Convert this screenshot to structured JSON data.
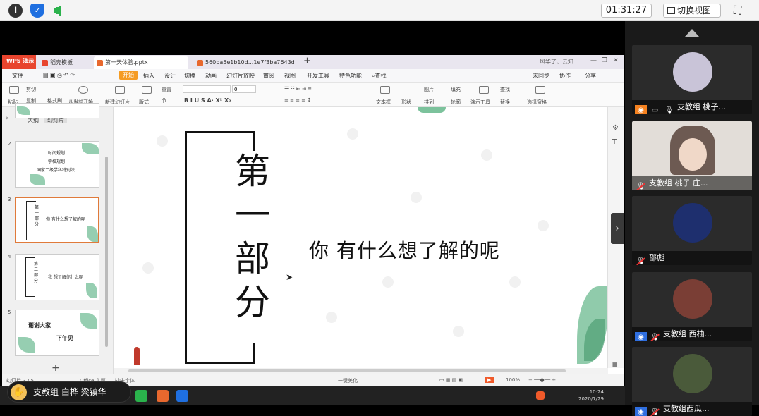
{
  "meeting": {
    "timer": "01:31:27",
    "view_switch_label": "切换视图"
  },
  "participants": [
    {
      "label": "支教组 桃子...",
      "avatar_color": "#c9c4d8"
    },
    {
      "label": "支教组 桃子 庄...",
      "avatar_color": "#e2ddd8"
    },
    {
      "label": "邵彪",
      "avatar_color": "#1e2f6e"
    },
    {
      "label": "支教组 西柚...",
      "avatar_color": "#7a3e35"
    },
    {
      "label": "支教组西瓜...",
      "avatar_color": "#4a5a3a"
    }
  ],
  "speaking": {
    "label": "支教组 白桦 梁镇华"
  },
  "wps": {
    "logo": "WPS 演示",
    "tabs": [
      {
        "label": "稻壳模板",
        "color": "#e8442e"
      },
      {
        "label": "第一天体验.pptx",
        "color": "#e8682e"
      },
      {
        "label": "560ba5e1b10d...1e7f3ba7643d",
        "color": "#e8682e"
      }
    ],
    "tab_right": "风华了、云知...",
    "menu": [
      "文件",
      "开始",
      "插入",
      "设计",
      "切换",
      "动画",
      "幻灯片放映",
      "审阅",
      "视图",
      "开发工具",
      "特色功能",
      "查找"
    ],
    "menu_right": [
      "未同步",
      "协作",
      "分享"
    ],
    "ribbon": {
      "paste": "粘贴",
      "cut": "剪切",
      "copy": "复制",
      "format_painter": "格式刷",
      "play_from_current": "从当前开始",
      "new_slide": "新建幻灯片",
      "layout": "版式",
      "section": "节",
      "reset": "重置",
      "font_size": "0",
      "textbox": "文本框",
      "shape": "形状",
      "arrange": "排列",
      "picture": "图片",
      "fill": "填充",
      "outline": "轮廓",
      "presentation_tools": "演示工具",
      "replace": "替换",
      "select_pane": "选择窗格",
      "find": "查找"
    },
    "thumb_tabs": [
      "大纲",
      "幻灯片"
    ],
    "thumbnails": [
      {
        "num": "2",
        "lines": [
          "时间规划",
          "学校规划",
          "国家二级学科特别法"
        ]
      },
      {
        "num": "3",
        "vertical": "第一部分",
        "text": "你 有什么想了解的呢"
      },
      {
        "num": "4",
        "vertical": "第二部分",
        "text": "我 想了解你什么呢"
      },
      {
        "num": "5",
        "lines": [
          "谢谢大家",
          "下午见"
        ]
      }
    ],
    "slide": {
      "vertical_title": [
        "第",
        "一",
        "部",
        "分"
      ],
      "subtitle": "你  有什么想了解的呢"
    },
    "status": {
      "left": "幻灯片 3 / 5",
      "theme": "Office 主题",
      "font": "缺失字体",
      "beautify": "一键美化",
      "zoom": "100%",
      "clock_time": "10:24",
      "clock_date": "2020/7/29"
    }
  }
}
